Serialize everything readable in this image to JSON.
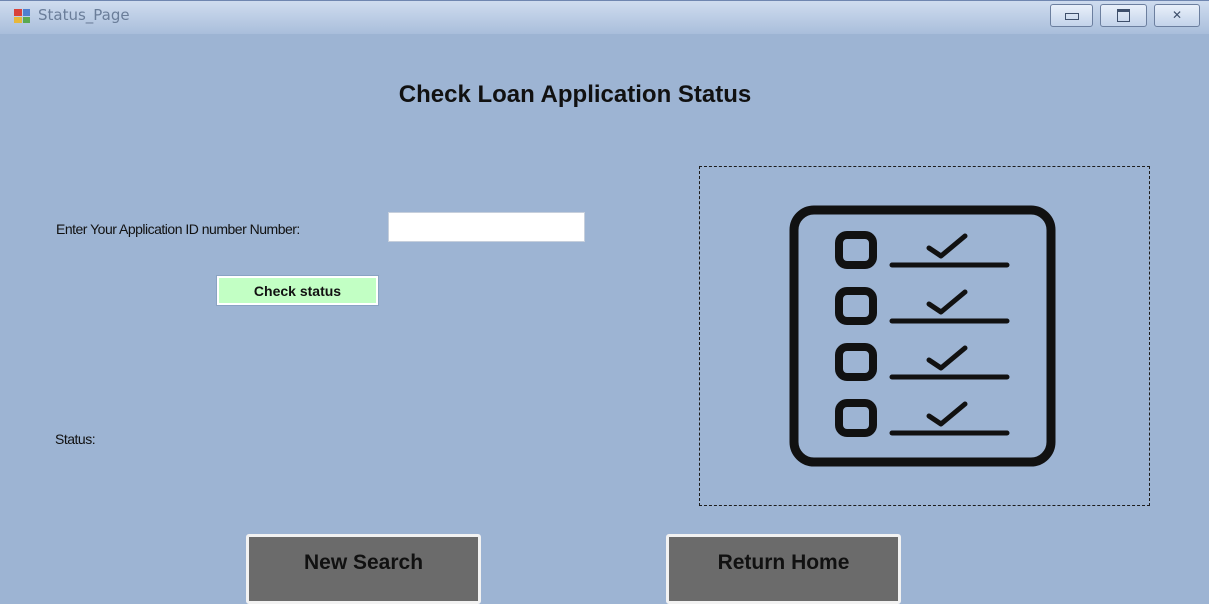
{
  "window": {
    "title": "Status_Page",
    "controls": {
      "minimize": "minimize",
      "maximize": "maximize",
      "close": "✕"
    }
  },
  "page": {
    "title": "Check Loan Application Status"
  },
  "form": {
    "id_label": "Enter Your Application ID number Number:",
    "id_value": "",
    "check_button": "Check status",
    "status_label": "Status:"
  },
  "picture": {
    "icon": "checklist-icon",
    "rows": 4
  },
  "buttons": {
    "new_search": "New Search",
    "return_home": "Return Home"
  },
  "colors": {
    "background": "#9db4d3",
    "check_button": "#c2ffc4",
    "nav_button": "#6b6b6b"
  }
}
